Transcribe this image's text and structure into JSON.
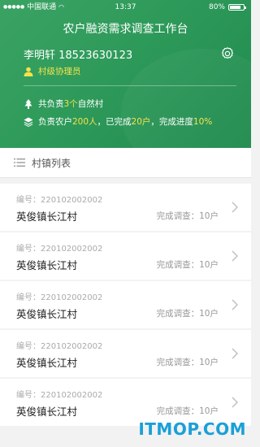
{
  "status_bar": {
    "carrier": "中国联通",
    "time": "13:37",
    "battery_pct": "80%",
    "battery_level": 0.8
  },
  "header": {
    "title": "农户融资需求调查工作台",
    "user_name": "李明轩 18523630123",
    "role": "村级协理员",
    "stat1_prefix": "共负责",
    "stat1_value": "3个",
    "stat1_suffix": "自然村",
    "stat2_prefix": "负责农户",
    "stat2_households": "200人",
    "stat2_mid": "，已完成",
    "stat2_done": "20户",
    "stat2_mid2": "，完成进度",
    "stat2_progress": "10%",
    "accent_color": "#f5e24a",
    "bg_color": "#2e9a5a"
  },
  "list": {
    "title": "村镇列表",
    "items": [
      {
        "code": "编号：220102002002",
        "name": "英俊镇长江村",
        "status": "完成调查：10户"
      },
      {
        "code": "编号：220102002002",
        "name": "英俊镇长江村",
        "status": "完成调查：10户"
      },
      {
        "code": "编号：220102002002",
        "name": "英俊镇长江村",
        "status": "完成调查：10户"
      },
      {
        "code": "编号：220102002002",
        "name": "英俊镇长江村",
        "status": "完成调查：10户"
      },
      {
        "code": "编号：220102002002",
        "name": "英俊镇长江村",
        "status": "完成调查：10户"
      }
    ]
  },
  "watermark": "ITMOP.COM"
}
